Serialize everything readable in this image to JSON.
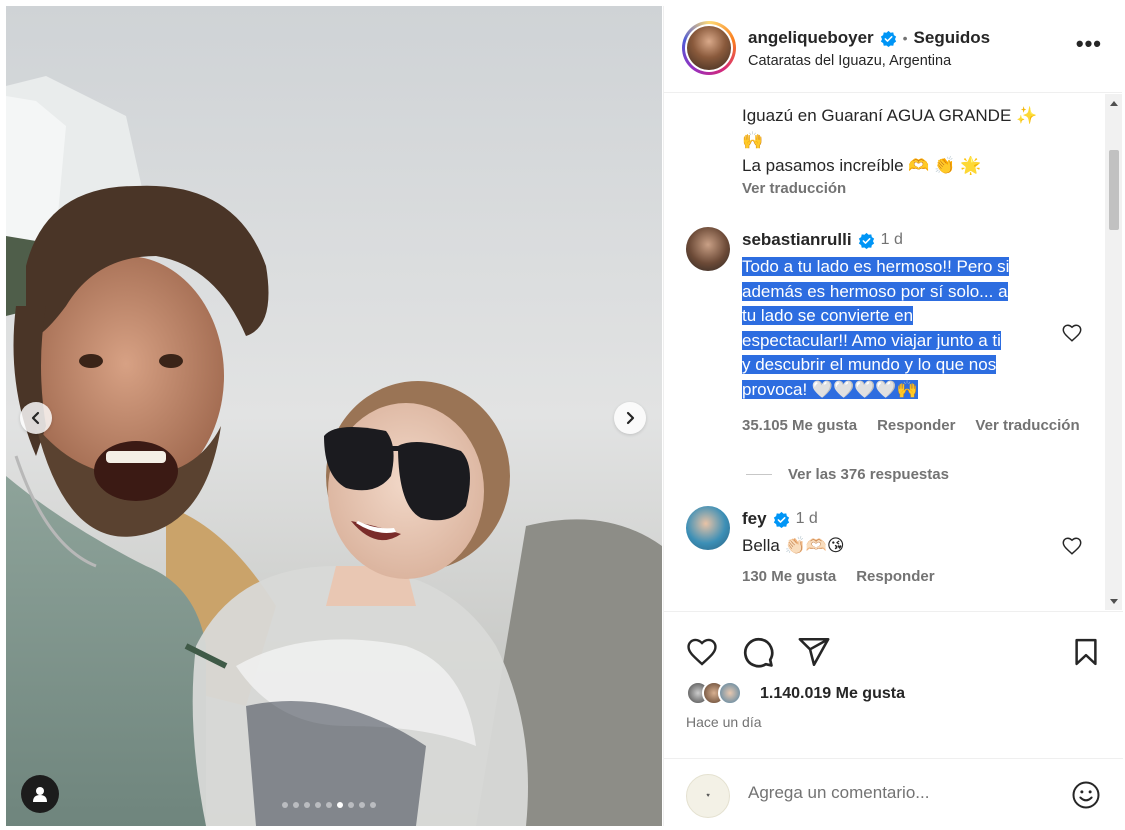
{
  "post": {
    "username": "angeliqueboyer",
    "follow_status": "Seguidos",
    "separator": "•",
    "location": "Cataratas del Iguazu, Argentina",
    "more_label": "•••"
  },
  "caption": {
    "line1": "Iguazú en Guaraní AGUA GRANDE ✨",
    "line2": "🙌",
    "line3": "La pasamos increíble 🫶 👏 🌟",
    "see_translation": "Ver traducción"
  },
  "comments": [
    {
      "username": "sebastianrulli",
      "time": "1 d",
      "lines": [
        "Todo a tu lado es hermoso!! Pero si",
        "además es hermoso por sí solo... a",
        "tu lado se convierte en",
        "espectacular!! Amo viajar junto a ti",
        "y descubrir el mundo y lo que nos",
        "provoca! 🤍🤍🤍🤍🙌"
      ],
      "likes": "35.105 Me gusta",
      "reply": "Responder",
      "translate": "Ver traducción",
      "view_replies": "Ver las 376 respuestas"
    },
    {
      "username": "fey",
      "time": "1 d",
      "text": "Bella 👏🏻🫶🏻😘",
      "likes": "130 Me gusta",
      "reply": "Responder"
    }
  ],
  "stats": {
    "likes": "1.140.019 Me gusta",
    "posted": "Hace un día"
  },
  "add_comment": {
    "placeholder": "Agrega un comentario..."
  },
  "carousel": {
    "dot_count": 9,
    "active_index": 5
  },
  "colors": {
    "selection": "#2d6de0",
    "verified": "#0095f6",
    "text": "#262626",
    "muted": "#737373"
  }
}
